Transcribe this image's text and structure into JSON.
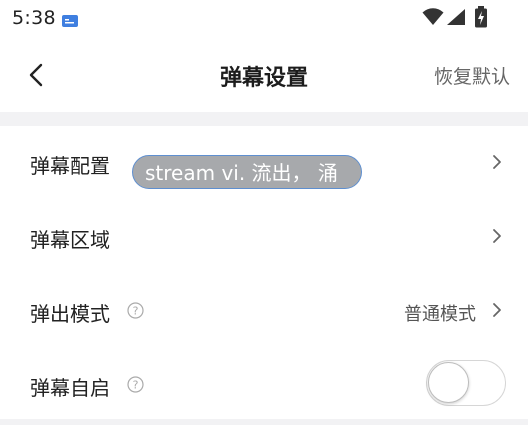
{
  "status_bar": {
    "time": "5:38",
    "icons": [
      "notification-icon",
      "wifi-icon",
      "signal-icon",
      "battery-charging-icon"
    ]
  },
  "header": {
    "back_icon": "chevron-left-icon",
    "title": "弹幕设置",
    "restore_label": "恢复默认"
  },
  "settings": {
    "items": [
      {
        "label": "弹幕配置",
        "has_chevron": true
      },
      {
        "label": "弹幕区域",
        "has_chevron": true
      },
      {
        "label": "弹出模式",
        "help_icon": "help-circle-icon",
        "value": "普通模式",
        "has_chevron": true
      },
      {
        "label": "弹幕自启",
        "help_icon": "help-circle-icon",
        "toggle_on": false
      }
    ]
  },
  "overlay": {
    "text": "stream vi. 流出， 涌"
  },
  "colors": {
    "accent_border": "#5e8fd0",
    "tooltip_bg": "#a7a9ac",
    "divider": "#f2f2f4"
  }
}
